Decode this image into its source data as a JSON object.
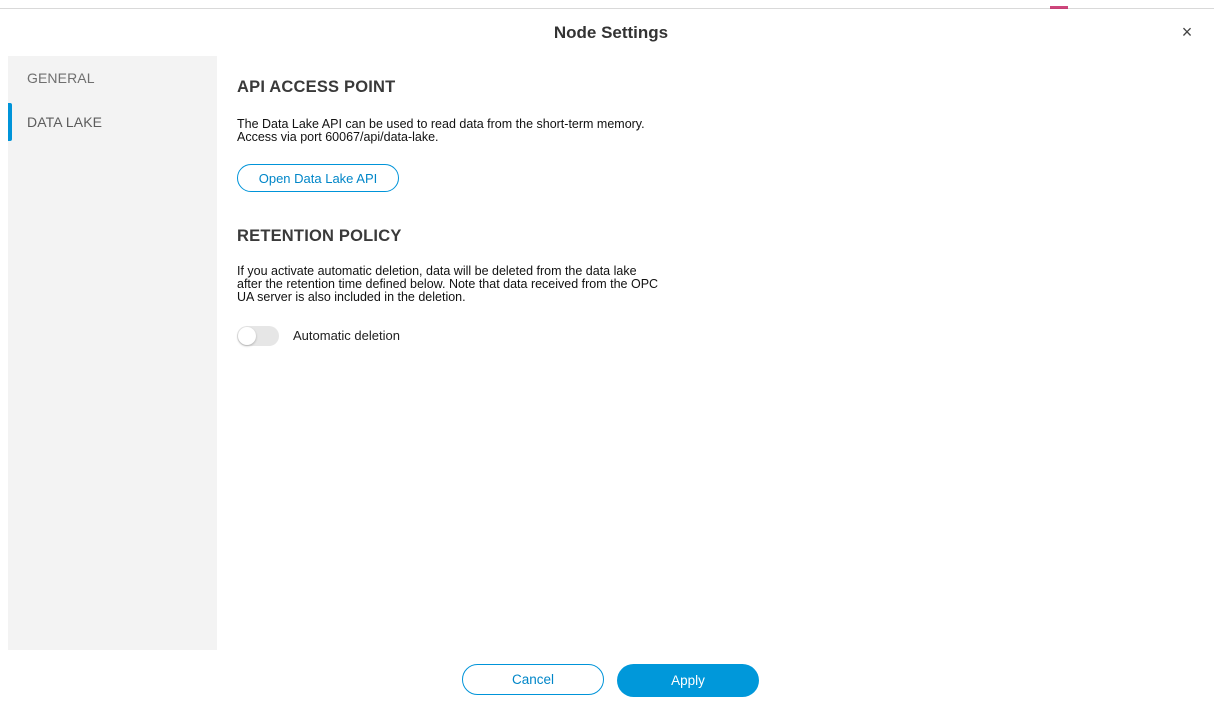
{
  "header": {
    "title": "Node Settings",
    "close_icon": "×"
  },
  "sidebar": {
    "items": [
      {
        "label": "GENERAL",
        "active": false
      },
      {
        "label": "DATA LAKE",
        "active": true
      }
    ]
  },
  "api_section": {
    "title": "API ACCESS POINT",
    "description_lines": [
      "The Data Lake API can be used to read data from the short-term memory.",
      "Access via port 60067/api/data-lake."
    ],
    "button_label": "Open Data Lake API"
  },
  "retention_section": {
    "title": "RETENTION POLICY",
    "description_lines": [
      "If you activate automatic deletion, data will be deleted from the data lake",
      "after the retention time defined below. Note that data received from the OPC",
      "UA server is also included in the deletion."
    ],
    "toggle_label": "Automatic deletion",
    "toggle_on": false
  },
  "footer": {
    "cancel_label": "Cancel",
    "apply_label": "Apply"
  },
  "colors": {
    "accent": "#0098da",
    "sidebar_bg": "#f3f3f3"
  }
}
